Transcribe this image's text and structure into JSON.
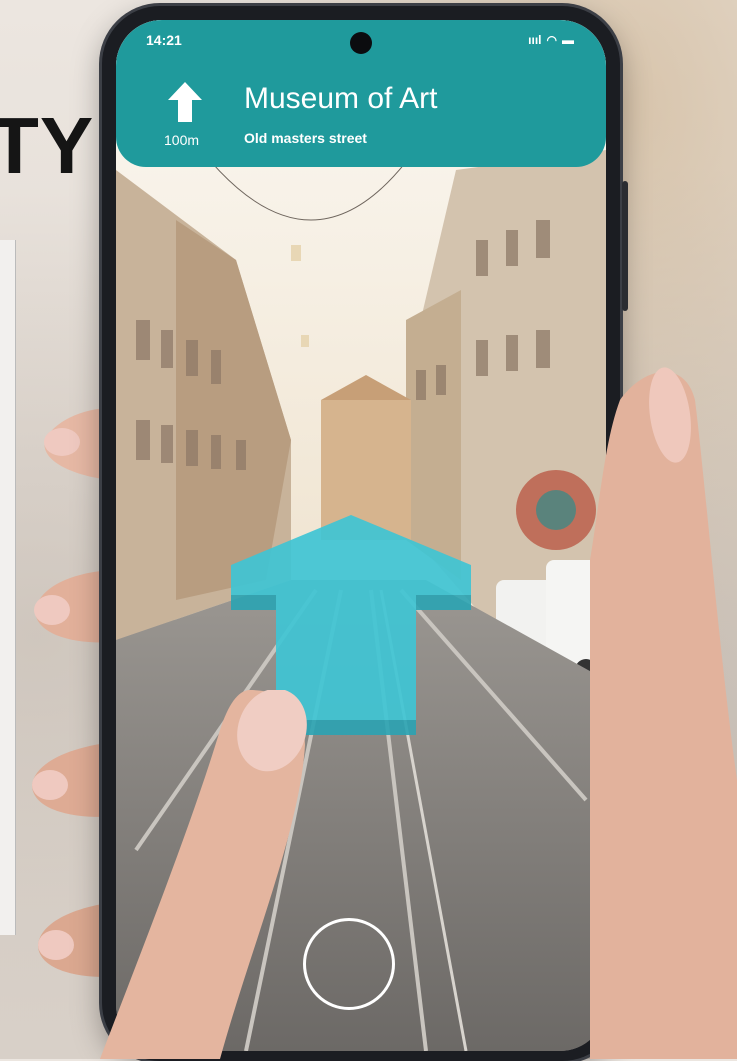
{
  "heading_fragment": "TY",
  "status_bar": {
    "time": "14:21",
    "signal": "ıııl",
    "wifi": "◠",
    "battery": "▬"
  },
  "navigation": {
    "direction_icon": "arrow-up-icon",
    "distance": "100m",
    "destination": "Museum of Art",
    "street": "Old masters street"
  },
  "colors": {
    "banner": "#1f9a9c",
    "ar_arrow": "#3fc4d4"
  },
  "camera": {
    "shutter_icon": "shutter-ring-icon"
  }
}
